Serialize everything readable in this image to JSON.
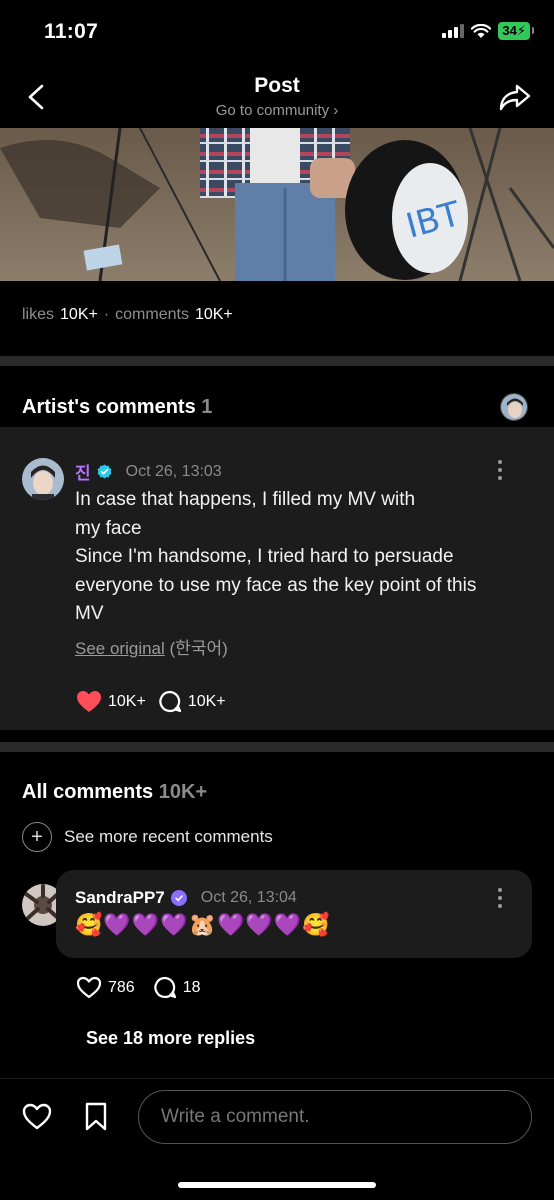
{
  "status_bar": {
    "time": "11:07",
    "battery": "34"
  },
  "header": {
    "title": "Post",
    "subtitle": "Go to community ›",
    "back_icon": "chevron-left-icon",
    "share_icon": "share-icon"
  },
  "stats": {
    "likes_label": "likes",
    "likes_value": "10K+",
    "separator": "·",
    "comments_label": "comments",
    "comments_value": "10K+"
  },
  "artist_section": {
    "title": "Artist's comments",
    "count": "1",
    "comment": {
      "name": "진",
      "date": "Oct 26, 13:03",
      "text_lines": [
        "In case that happens, I filled my MV with",
        "my face",
        "Since I'm handsome, I tried hard to persuade",
        "everyone to use my face as the key point of this",
        "MV"
      ],
      "see_original": "See original",
      "original_lang": "(한국어)",
      "likes": "10K+",
      "replies": "10K+"
    }
  },
  "all_comments": {
    "title": "All comments",
    "count": "10K+",
    "see_recent": "See more recent comments",
    "comment": {
      "name": "SandraPP7",
      "date": "Oct 26, 13:04",
      "text": "🥰💜💜💜🐹💜💜💜🥰",
      "likes": "786",
      "replies": "18"
    },
    "see_replies": "See 18 more replies"
  },
  "bottom_bar": {
    "placeholder": "Write a comment."
  },
  "colors": {
    "accent_purple": "#b673ff",
    "verified_blue": "#2fc8e8",
    "heart_red": "#ff4d5a",
    "battery_green": "#34c759"
  }
}
